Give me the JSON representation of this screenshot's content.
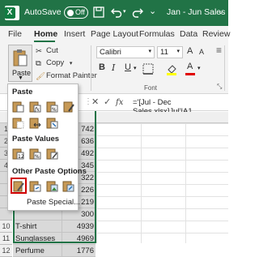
{
  "titlebar": {
    "autosave_label": "AutoSave",
    "autosave_state": "Off",
    "doc_title": "Jan - Jun Sales",
    "chevron": "⌄",
    "accent": "#217346"
  },
  "tabs": [
    "File",
    "Home",
    "Insert",
    "Page Layout",
    "Formulas",
    "Data",
    "Review"
  ],
  "active_tab": "Home",
  "clipboard": {
    "paste_label": "Paste",
    "cut_label": "Cut",
    "copy_label": "Copy",
    "format_painter_label": "Format Painter"
  },
  "font": {
    "name": "Calibri",
    "size": "11",
    "group_label": "Font",
    "bold": "B",
    "italic": "I",
    "underline": "U",
    "grow": "A",
    "shrink": "A"
  },
  "formula_bar": {
    "fx": "fx",
    "formula": "='[Jul - Dec Sales.xlsx]Jul'!A1"
  },
  "dropdown": {
    "paste_heading": "Paste",
    "paste_values_heading": "Paste Values",
    "other_heading": "Other Paste Options",
    "paste_special": "Paste Special..."
  },
  "rows": [
    {
      "num": "",
      "name": "",
      "value": "742"
    },
    {
      "num": "",
      "name": "",
      "value": "636"
    },
    {
      "num": "",
      "name": "",
      "value": "492"
    },
    {
      "num": "",
      "name": "",
      "value": "345"
    },
    {
      "num": "",
      "name": "",
      "value": "322"
    },
    {
      "num": "",
      "name": "",
      "value": "226"
    },
    {
      "num": "",
      "name": "",
      "value": "219"
    },
    {
      "num": "",
      "name": "",
      "value": "300"
    },
    {
      "num": "10",
      "name": "T-shirt",
      "value": "4939"
    },
    {
      "num": "11",
      "name": "Sunglasses",
      "value": "4969"
    },
    {
      "num": "12",
      "name": "Perfume",
      "value": "1776"
    }
  ],
  "visible_row_numbers": [
    "1",
    "2",
    "3",
    "4"
  ]
}
